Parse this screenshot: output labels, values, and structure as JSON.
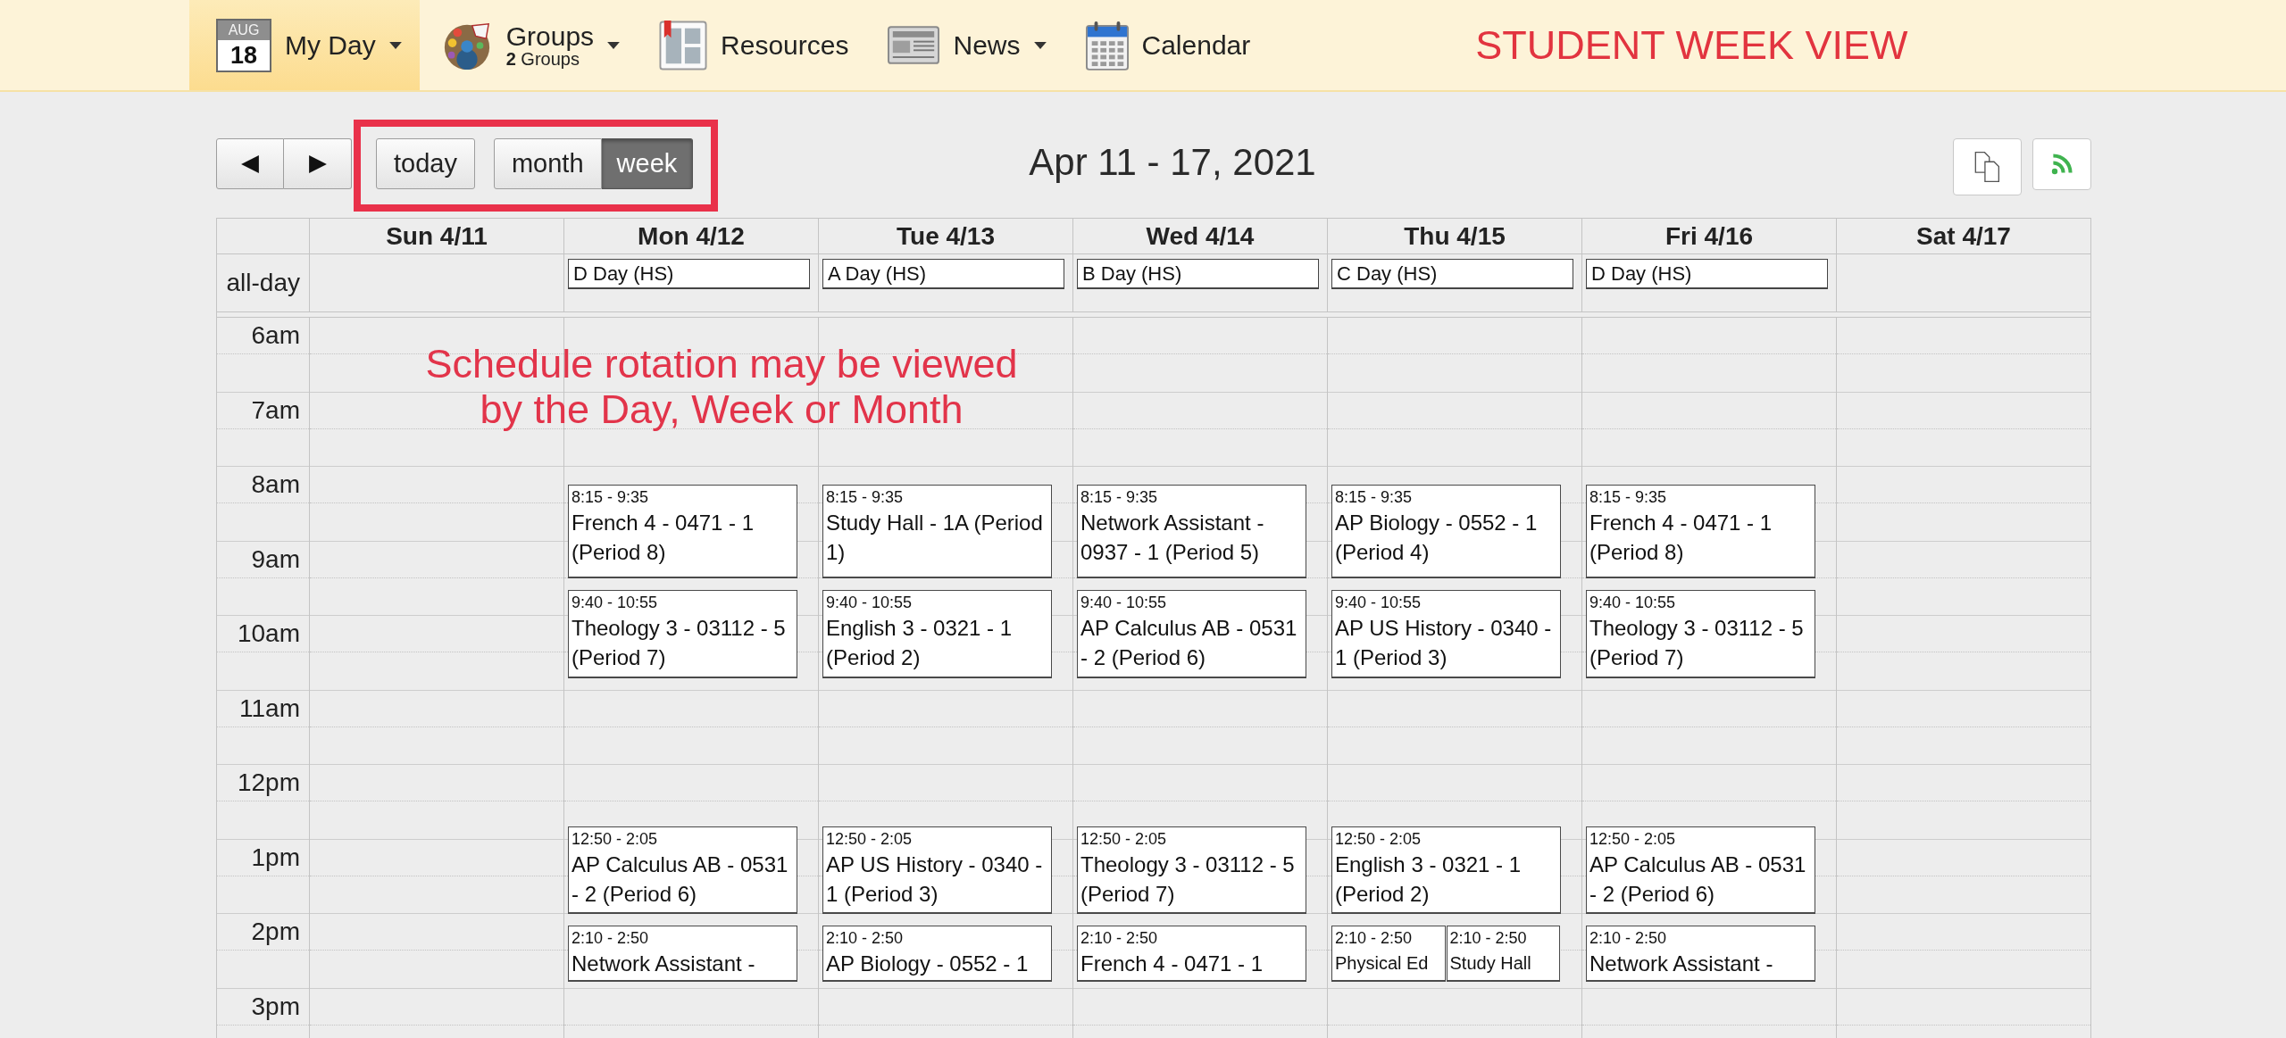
{
  "nav": {
    "items": [
      {
        "kind": "myday",
        "label": "My Day",
        "month": "AUG",
        "day": "18",
        "dropdown": true,
        "selected": true
      },
      {
        "kind": "groups",
        "label": "Groups",
        "sublabel": "**2** Groups",
        "dropdown": true,
        "selected": false
      },
      {
        "kind": "resources",
        "label": "Resources",
        "dropdown": false,
        "selected": false
      },
      {
        "kind": "news",
        "label": "News",
        "dropdown": true,
        "selected": false
      },
      {
        "kind": "calendar",
        "label": "Calendar",
        "dropdown": false,
        "selected": false
      }
    ],
    "caption": "STUDENT WEEK VIEW"
  },
  "toolbar": {
    "today": "today",
    "views": [
      {
        "label": "month",
        "selected": false
      },
      {
        "label": "week",
        "selected": true
      }
    ],
    "title": "Apr 11 - 17, 2021"
  },
  "calendar": {
    "all_day_label": "all-day",
    "hours": [
      "6am",
      "7am",
      "8am",
      "9am",
      "10am",
      "11am",
      "12pm",
      "1pm",
      "2pm",
      "3pm"
    ],
    "days": [
      {
        "label": "Sun 4/11"
      },
      {
        "label": "Mon 4/12",
        "all_day": [
          "D Day (HS)"
        ],
        "events": [
          {
            "time": "8:15 - 9:35",
            "title": "French 4 - 0471 - 1 (Period 8)"
          },
          {
            "time": "9:40 - 10:55",
            "title": "Theology 3 - 03112 - 5 (Period 7)"
          },
          {
            "time": "12:50 - 2:05",
            "title": "AP Calculus AB - 0531 - 2 (Period 6)"
          },
          {
            "time": "2:10 - 2:50",
            "title": "Network Assistant -"
          }
        ]
      },
      {
        "label": "Tue 4/13",
        "all_day": [
          "A Day (HS)"
        ],
        "events": [
          {
            "time": "8:15 - 9:35",
            "title": "Study Hall - 1A (Period 1)"
          },
          {
            "time": "9:40 - 10:55",
            "title": "English 3 - 0321 - 1 (Period 2)"
          },
          {
            "time": "12:50 - 2:05",
            "title": "AP US History - 0340 - 1 (Period 3)"
          },
          {
            "time": "2:10 - 2:50",
            "title": "AP Biology - 0552 - 1"
          }
        ]
      },
      {
        "label": "Wed 4/14",
        "all_day": [
          "B Day (HS)"
        ],
        "events": [
          {
            "time": "8:15 - 9:35",
            "title": "Network Assistant - 0937 - 1 (Period 5)"
          },
          {
            "time": "9:40 - 10:55",
            "title": "AP Calculus AB - 0531 - 2 (Period 6)"
          },
          {
            "time": "12:50 - 2:05",
            "title": "Theology 3 - 03112 - 5 (Period 7)"
          },
          {
            "time": "2:10 - 2:50",
            "title": "French 4 - 0471 - 1"
          }
        ]
      },
      {
        "label": "Thu 4/15",
        "all_day": [
          "C Day (HS)"
        ],
        "events": [
          {
            "time": "8:15 - 9:35",
            "title": "AP Biology - 0552 - 1 (Period 4)"
          },
          {
            "time": "9:40 - 10:55",
            "title": "AP US History - 0340 - 1 (Period 3)"
          },
          {
            "time": "12:50 - 2:05",
            "title": "English 3 - 0321 - 1 (Period 2)"
          },
          {
            "time": "2:10 - 2:50",
            "title": "Physical Ed"
          },
          {
            "time": "2:10 - 2:50",
            "title": "Study Hall"
          }
        ]
      },
      {
        "label": "Fri 4/16",
        "all_day": [
          "D Day (HS)"
        ],
        "events": [
          {
            "time": "8:15 - 9:35",
            "title": "French 4 - 0471 - 1 (Period 8)"
          },
          {
            "time": "9:40 - 10:55",
            "title": "Theology 3 - 03112 - 5 (Period 7)"
          },
          {
            "time": "12:50 - 2:05",
            "title": "AP Calculus AB - 0531 - 2 (Period 6)"
          },
          {
            "time": "2:10 - 2:50",
            "title": "Network Assistant -"
          }
        ]
      },
      {
        "label": "Sat 4/17"
      }
    ]
  },
  "note": [
    "Schedule rotation may be viewed",
    "by the Day, Week or Month"
  ]
}
